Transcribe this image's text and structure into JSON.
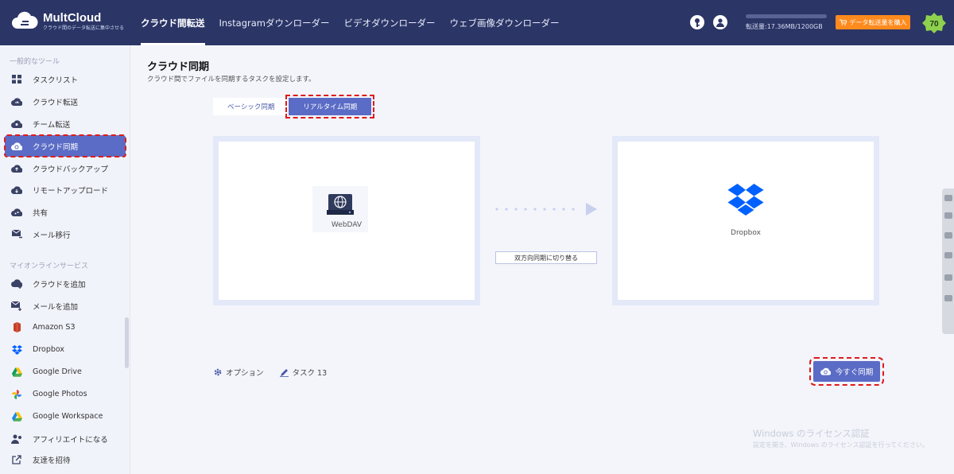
{
  "header": {
    "logo_title": "MultCloud",
    "logo_subtitle": "クラウド間のデータ転送に集中させる",
    "nav": [
      {
        "label": "クラウド間転送",
        "active": true
      },
      {
        "label": "Instagramダウンローダー",
        "active": false
      },
      {
        "label": "ビデオダウンローダー",
        "active": false
      },
      {
        "label": "ウェブ画像ダウンローダー",
        "active": false
      }
    ],
    "traffic_text": "転送量:17.36MB/1200GB",
    "traffic_fraction": 1.45e-05,
    "buy_label": "データ転送量を購入",
    "vip_badge": "70",
    "icons": [
      "key-icon",
      "user-icon"
    ]
  },
  "sidebar": {
    "section_tools": "一般的なツール",
    "tools": [
      {
        "label": "タスクリスト",
        "icon": "task-list-icon"
      },
      {
        "label": "クラウド転送",
        "icon": "cloud-transfer-icon"
      },
      {
        "label": "チーム転送",
        "icon": "team-transfer-icon"
      },
      {
        "label": "クラウド同期",
        "icon": "cloud-sync-icon",
        "active": true
      },
      {
        "label": "クラウドバックアップ",
        "icon": "cloud-backup-icon"
      },
      {
        "label": "リモートアップロード",
        "icon": "remote-upload-icon"
      },
      {
        "label": "共有",
        "icon": "share-icon"
      },
      {
        "label": "メール移行",
        "icon": "email-migration-icon"
      }
    ],
    "section_services": "マイオンラインサービス",
    "services": [
      {
        "label": "クラウドを追加",
        "icon": "add-cloud-icon"
      },
      {
        "label": "メールを追加",
        "icon": "add-email-icon"
      },
      {
        "label": "Amazon S3",
        "icon": "amazon-s3-icon"
      },
      {
        "label": "Dropbox",
        "icon": "dropbox-icon"
      },
      {
        "label": "Google Drive",
        "icon": "google-drive-icon"
      },
      {
        "label": "Google Photos",
        "icon": "google-photos-icon"
      },
      {
        "label": "Google Workspace",
        "icon": "google-workspace-icon"
      },
      {
        "label": "アフィリエイトになる",
        "icon": "affiliate-icon"
      },
      {
        "label": "友達を招待",
        "icon": "invite-icon"
      }
    ]
  },
  "main": {
    "title": "クラウド同期",
    "description": "クラウド間でファイルを同期するタスクを設定します。",
    "tabs": [
      {
        "label": "ベーシック同期",
        "active": false
      },
      {
        "label": "リアルタイム同期",
        "active": true
      }
    ],
    "source_label": "WebDAV",
    "target_label": "Dropbox",
    "switch_label": "双方向同期に切り替る",
    "options_label": "オプション",
    "task_label": "タスク 13",
    "sync_now_label": "今すぐ同期"
  },
  "watermark": {
    "line1": "Windows のライセンス認証",
    "line2": "設定を開き、Windows のライセンス認証を行ってください。"
  },
  "colors": {
    "header_bg": "#2b3566",
    "accent": "#5b6cc6",
    "buy_orange": "#ff8a1d",
    "highlight_red": "#e01b1b"
  }
}
